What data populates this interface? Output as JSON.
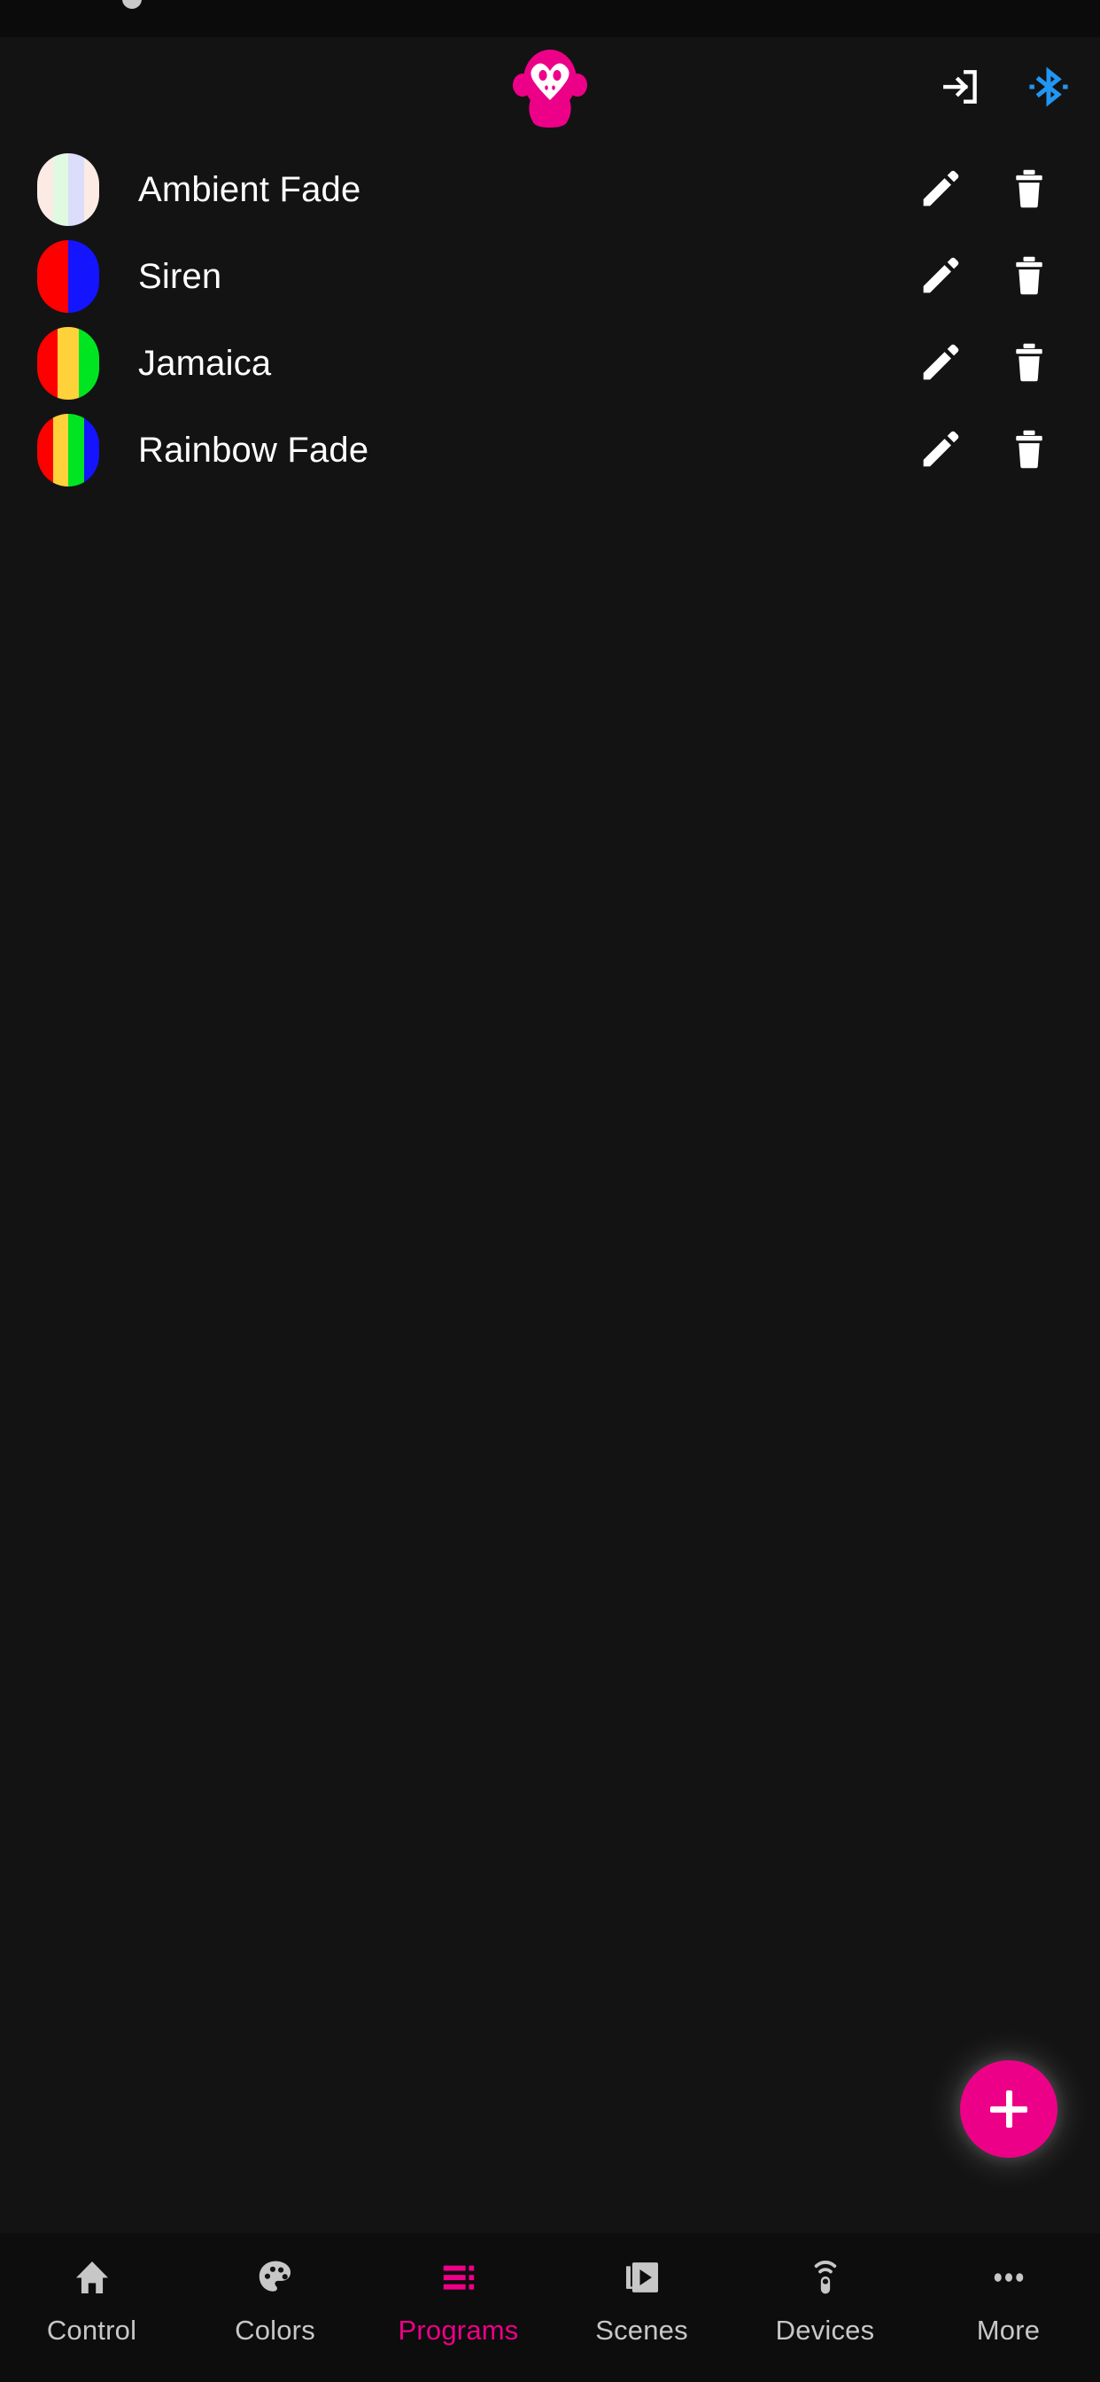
{
  "theme": {
    "background": "#131313",
    "appbar_background": "#131313",
    "statusbar_background": "#0b0b0b",
    "bottomnav_background": "#0d0d0d",
    "accent_pink": "#ED0088",
    "bluetooth_blue": "#2196F3",
    "text_primary": "#FFFFFF",
    "nav_inactive": "#C7C7C7"
  },
  "appbar": {
    "logo_icon": "monkey-logo-icon",
    "logo_color": "#ED0088",
    "actions": [
      {
        "icon": "login-icon",
        "label": "Login",
        "color": "#FFFFFF"
      },
      {
        "icon": "bluetooth-icon",
        "label": "Bluetooth",
        "color": "#2196F3"
      }
    ]
  },
  "programs": [
    {
      "name": "Ambient Fade",
      "colors": [
        "#FBEBE4",
        "#E0FAE2",
        "#DCDCFB",
        "#FBEBE4"
      ],
      "edit_icon": "pencil-icon",
      "delete_icon": "trash-icon"
    },
    {
      "name": "Siren",
      "colors": [
        "#FF0000",
        "#1414FF"
      ],
      "edit_icon": "pencil-icon",
      "delete_icon": "trash-icon"
    },
    {
      "name": "Jamaica",
      "colors": [
        "#FF0000",
        "#FFD13B",
        "#00E522"
      ],
      "edit_icon": "pencil-icon",
      "delete_icon": "trash-icon"
    },
    {
      "name": "Rainbow Fade",
      "colors": [
        "#FF0000",
        "#FFD13B",
        "#00E522",
        "#1414FF"
      ],
      "edit_icon": "pencil-icon",
      "delete_icon": "trash-icon"
    }
  ],
  "fab": {
    "icon": "plus-icon",
    "label": "Add program",
    "color": "#ED0088"
  },
  "bottom_nav": {
    "active_index": 2,
    "items": [
      {
        "label": "Control",
        "icon": "home-icon"
      },
      {
        "label": "Colors",
        "icon": "palette-icon"
      },
      {
        "label": "Programs",
        "icon": "list-icon"
      },
      {
        "label": "Scenes",
        "icon": "slideshow-icon"
      },
      {
        "label": "Devices",
        "icon": "remote-icon"
      },
      {
        "label": "More",
        "icon": "more-dots-icon"
      }
    ]
  }
}
